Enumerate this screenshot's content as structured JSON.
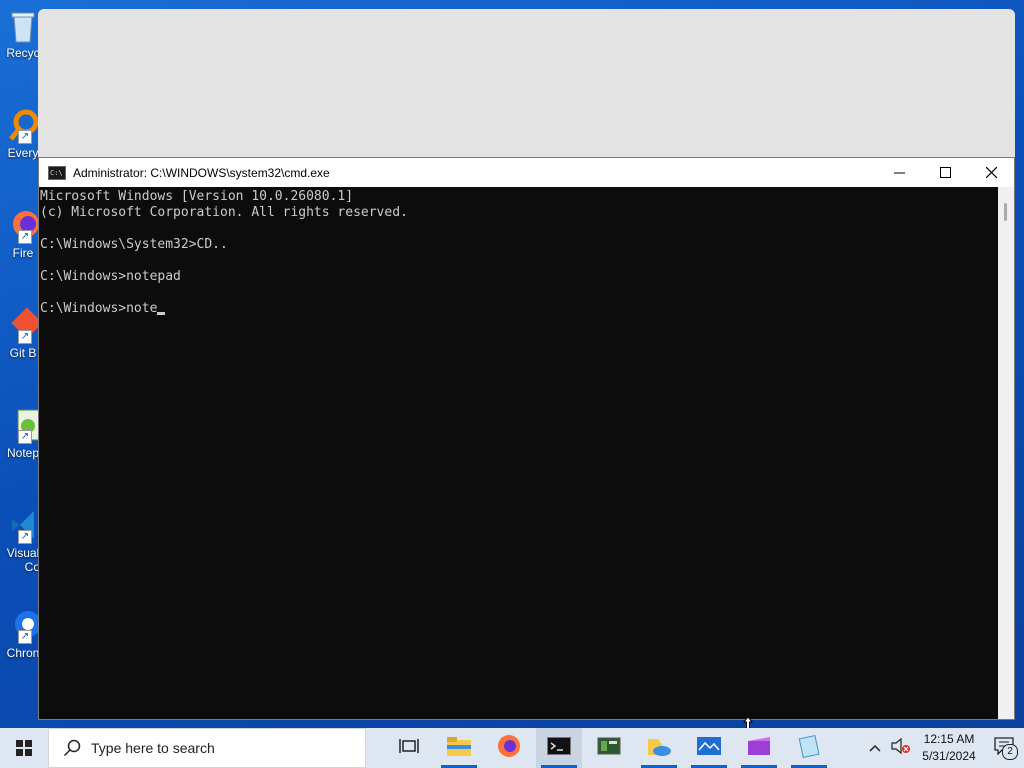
{
  "desktop": {
    "icons": [
      {
        "label": "Recyc",
        "icon": "recycle-bin-icon"
      },
      {
        "label": "Every",
        "icon": "everything-icon"
      },
      {
        "label": "Fire",
        "icon": "firefox-icon"
      },
      {
        "label": "Git B",
        "icon": "git-bash-icon"
      },
      {
        "label": "Notep",
        "icon": "notepad-plus-plus-icon"
      },
      {
        "label": "Visual",
        "label2": "Co",
        "icon": "visual-studio-code-icon"
      },
      {
        "label": "Chron",
        "icon": "chrome-icon"
      }
    ]
  },
  "cmd_window": {
    "title": "Administrator: C:\\WINDOWS\\system32\\cmd.exe",
    "lines": [
      "Microsoft Windows [Version 10.0.26080.1]",
      "(c) Microsoft Corporation. All rights reserved.",
      "",
      "C:\\Windows\\System32>CD..",
      "",
      "C:\\Windows>notepad",
      "",
      "C:\\Windows>note"
    ],
    "controls": {
      "minimize": "—",
      "maximize": "☐",
      "close": "✕"
    }
  },
  "taskbar": {
    "search_placeholder": "Type here to search",
    "apps": [
      {
        "name": "task-view-icon",
        "active": false
      },
      {
        "name": "file-explorer-icon",
        "active": false
      },
      {
        "name": "firefox-icon",
        "active": false
      },
      {
        "name": "command-prompt-icon",
        "active": true
      },
      {
        "name": "terminal-app-icon",
        "active": false
      },
      {
        "name": "onedrive-app-icon",
        "active": false
      },
      {
        "name": "image-viewer-icon",
        "active": false
      },
      {
        "name": "media-app-icon",
        "active": false
      },
      {
        "name": "notepad-app-icon",
        "active": false
      }
    ],
    "time": "12:15 AM",
    "date": "5/31/2024",
    "notification_count": "2"
  },
  "colors": {
    "desktop_bg": "#0b4fb8",
    "taskbar_bg": "#dde6f1",
    "console_bg": "#0c0c0c",
    "console_fg": "#cccccc",
    "accent": "#0a63d1"
  }
}
